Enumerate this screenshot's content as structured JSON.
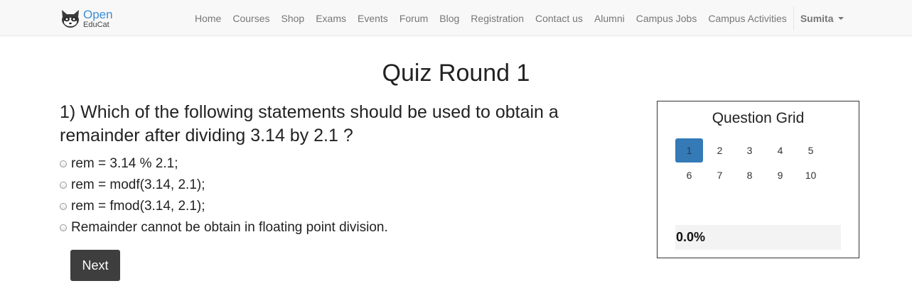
{
  "brand": {
    "line1": "Open",
    "line2": "EduCat",
    "icon": "raccoon-logo-icon"
  },
  "nav": {
    "items": [
      "Home",
      "Courses",
      "Shop",
      "Exams",
      "Events",
      "Forum",
      "Blog",
      "Registration",
      "Contact us",
      "Alumni",
      "Campus Jobs",
      "Campus Activities"
    ],
    "user": "Sumita"
  },
  "quiz": {
    "title": "Quiz Round 1",
    "question": "1) Which of the following statements should be used to obtain a remainder after dividing 3.14 by 2.1 ?",
    "options": [
      "rem = 3.14 % 2.1;",
      "rem = modf(3.14, 2.1);",
      "rem = fmod(3.14, 2.1);",
      "Remainder cannot be obtain in floating point division."
    ],
    "next_label": "Next"
  },
  "grid": {
    "title": "Question Grid",
    "questions": [
      "1",
      "2",
      "3",
      "4",
      "5",
      "6",
      "7",
      "8",
      "9",
      "10"
    ],
    "active_index": 0,
    "progress_percent": 0.0,
    "progress_label": "0.0%",
    "active_color": "#337ab7"
  }
}
